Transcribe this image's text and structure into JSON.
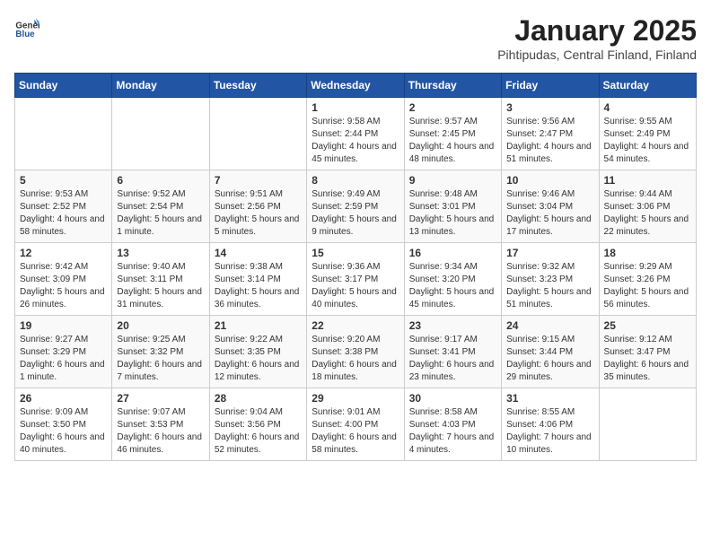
{
  "header": {
    "logo_general": "General",
    "logo_blue": "Blue",
    "month": "January 2025",
    "location": "Pihtipudas, Central Finland, Finland"
  },
  "weekdays": [
    "Sunday",
    "Monday",
    "Tuesday",
    "Wednesday",
    "Thursday",
    "Friday",
    "Saturday"
  ],
  "weeks": [
    [
      {
        "day": "",
        "info": ""
      },
      {
        "day": "",
        "info": ""
      },
      {
        "day": "",
        "info": ""
      },
      {
        "day": "1",
        "info": "Sunrise: 9:58 AM\nSunset: 2:44 PM\nDaylight: 4 hours and 45 minutes."
      },
      {
        "day": "2",
        "info": "Sunrise: 9:57 AM\nSunset: 2:45 PM\nDaylight: 4 hours and 48 minutes."
      },
      {
        "day": "3",
        "info": "Sunrise: 9:56 AM\nSunset: 2:47 PM\nDaylight: 4 hours and 51 minutes."
      },
      {
        "day": "4",
        "info": "Sunrise: 9:55 AM\nSunset: 2:49 PM\nDaylight: 4 hours and 54 minutes."
      }
    ],
    [
      {
        "day": "5",
        "info": "Sunrise: 9:53 AM\nSunset: 2:52 PM\nDaylight: 4 hours and 58 minutes."
      },
      {
        "day": "6",
        "info": "Sunrise: 9:52 AM\nSunset: 2:54 PM\nDaylight: 5 hours and 1 minute."
      },
      {
        "day": "7",
        "info": "Sunrise: 9:51 AM\nSunset: 2:56 PM\nDaylight: 5 hours and 5 minutes."
      },
      {
        "day": "8",
        "info": "Sunrise: 9:49 AM\nSunset: 2:59 PM\nDaylight: 5 hours and 9 minutes."
      },
      {
        "day": "9",
        "info": "Sunrise: 9:48 AM\nSunset: 3:01 PM\nDaylight: 5 hours and 13 minutes."
      },
      {
        "day": "10",
        "info": "Sunrise: 9:46 AM\nSunset: 3:04 PM\nDaylight: 5 hours and 17 minutes."
      },
      {
        "day": "11",
        "info": "Sunrise: 9:44 AM\nSunset: 3:06 PM\nDaylight: 5 hours and 22 minutes."
      }
    ],
    [
      {
        "day": "12",
        "info": "Sunrise: 9:42 AM\nSunset: 3:09 PM\nDaylight: 5 hours and 26 minutes."
      },
      {
        "day": "13",
        "info": "Sunrise: 9:40 AM\nSunset: 3:11 PM\nDaylight: 5 hours and 31 minutes."
      },
      {
        "day": "14",
        "info": "Sunrise: 9:38 AM\nSunset: 3:14 PM\nDaylight: 5 hours and 36 minutes."
      },
      {
        "day": "15",
        "info": "Sunrise: 9:36 AM\nSunset: 3:17 PM\nDaylight: 5 hours and 40 minutes."
      },
      {
        "day": "16",
        "info": "Sunrise: 9:34 AM\nSunset: 3:20 PM\nDaylight: 5 hours and 45 minutes."
      },
      {
        "day": "17",
        "info": "Sunrise: 9:32 AM\nSunset: 3:23 PM\nDaylight: 5 hours and 51 minutes."
      },
      {
        "day": "18",
        "info": "Sunrise: 9:29 AM\nSunset: 3:26 PM\nDaylight: 5 hours and 56 minutes."
      }
    ],
    [
      {
        "day": "19",
        "info": "Sunrise: 9:27 AM\nSunset: 3:29 PM\nDaylight: 6 hours and 1 minute."
      },
      {
        "day": "20",
        "info": "Sunrise: 9:25 AM\nSunset: 3:32 PM\nDaylight: 6 hours and 7 minutes."
      },
      {
        "day": "21",
        "info": "Sunrise: 9:22 AM\nSunset: 3:35 PM\nDaylight: 6 hours and 12 minutes."
      },
      {
        "day": "22",
        "info": "Sunrise: 9:20 AM\nSunset: 3:38 PM\nDaylight: 6 hours and 18 minutes."
      },
      {
        "day": "23",
        "info": "Sunrise: 9:17 AM\nSunset: 3:41 PM\nDaylight: 6 hours and 23 minutes."
      },
      {
        "day": "24",
        "info": "Sunrise: 9:15 AM\nSunset: 3:44 PM\nDaylight: 6 hours and 29 minutes."
      },
      {
        "day": "25",
        "info": "Sunrise: 9:12 AM\nSunset: 3:47 PM\nDaylight: 6 hours and 35 minutes."
      }
    ],
    [
      {
        "day": "26",
        "info": "Sunrise: 9:09 AM\nSunset: 3:50 PM\nDaylight: 6 hours and 40 minutes."
      },
      {
        "day": "27",
        "info": "Sunrise: 9:07 AM\nSunset: 3:53 PM\nDaylight: 6 hours and 46 minutes."
      },
      {
        "day": "28",
        "info": "Sunrise: 9:04 AM\nSunset: 3:56 PM\nDaylight: 6 hours and 52 minutes."
      },
      {
        "day": "29",
        "info": "Sunrise: 9:01 AM\nSunset: 4:00 PM\nDaylight: 6 hours and 58 minutes."
      },
      {
        "day": "30",
        "info": "Sunrise: 8:58 AM\nSunset: 4:03 PM\nDaylight: 7 hours and 4 minutes."
      },
      {
        "day": "31",
        "info": "Sunrise: 8:55 AM\nSunset: 4:06 PM\nDaylight: 7 hours and 10 minutes."
      },
      {
        "day": "",
        "info": ""
      }
    ]
  ]
}
